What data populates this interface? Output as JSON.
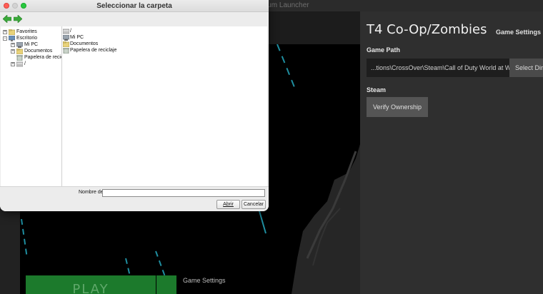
{
  "launcher": {
    "title": "ium Launcher",
    "game_title": "T4 Co-Op/Zombies",
    "game_settings_subtitle": "Game Settings",
    "game_path_label": "Game Path",
    "game_path_value": "...tions\\CrossOver\\Steam\\Call of Duty World at W",
    "select_dir_label": "Select Dir",
    "steam_label": "Steam",
    "verify_ownership_label": "Verify Ownership",
    "play_label": "PLAY",
    "bottom_settings_label": "Game Settings"
  },
  "dialog": {
    "title": "Seleccionar la carpeta",
    "tree": [
      {
        "label": "Favorites",
        "icon": "folder-icon",
        "expander": "+"
      },
      {
        "label": "Escritorio",
        "icon": "desktop-icon",
        "expander": "-"
      },
      {
        "label": "Mi PC",
        "icon": "computer-icon",
        "expander": "+"
      },
      {
        "label": "Documentos",
        "icon": "folder-icon",
        "expander": "+"
      },
      {
        "label": "Papelera de reciclaje",
        "icon": "recycle-bin-icon",
        "expander": ""
      },
      {
        "label": "/",
        "icon": "drive-icon",
        "expander": "+"
      }
    ],
    "list": [
      {
        "label": "/",
        "icon": "drive-icon"
      },
      {
        "label": "Mi PC",
        "icon": "computer-icon"
      },
      {
        "label": "Documentos",
        "icon": "folder-icon"
      },
      {
        "label": "Papelera de reciclaje",
        "icon": "recycle-bin-icon"
      }
    ],
    "name_label": "Nombre de",
    "name_value": "",
    "open_button": "Abrir",
    "cancel_button": "Cancelar"
  },
  "colors": {
    "accent_green": "#1c7a2c",
    "nav_arrow_green": "#3aa93a",
    "art_cyan": "#1f8ea0"
  }
}
